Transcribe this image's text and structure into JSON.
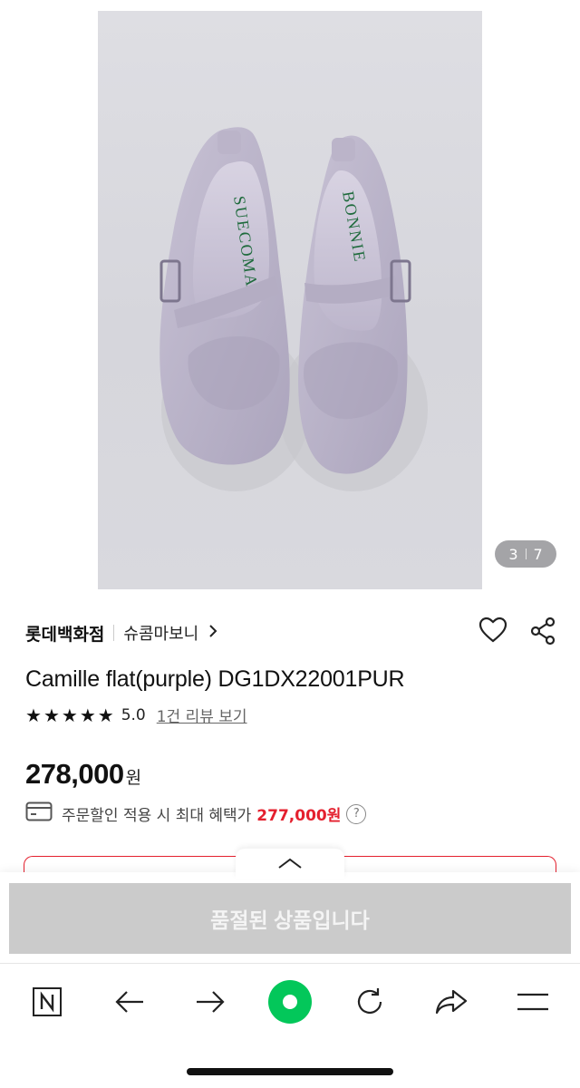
{
  "gallery": {
    "counter_current": "3",
    "counter_total": "7",
    "insole_left": "SUECOMA",
    "insole_right": "BONNIE"
  },
  "product": {
    "store": "롯데백화점",
    "brand": "슈콤마보니",
    "title": "Camille flat(purple) DG1DX22001PUR",
    "rating_value": 5.0,
    "rating_text": "5.0",
    "review_link": "1건 리뷰 보기",
    "price": "278,000",
    "price_unit": "원",
    "benefit_text": "주문할인 적용 시 최대 혜택가",
    "benefit_price": "277,000원",
    "help": "?"
  },
  "purchase": {
    "soldout_label": "품절된 상품입니다"
  },
  "icons": {
    "heart": "heart-icon",
    "share": "share-icon",
    "card": "card-icon",
    "chevron": "chevron-right-icon",
    "sheet_handle": "chevron-up-icon",
    "browser_home": "naver-n-icon",
    "back": "arrow-left-icon",
    "forward": "arrow-right-icon",
    "green_dot": "green-circle-icon",
    "reload": "reload-icon",
    "browser_share": "share-arrow-icon",
    "menu": "menu-icon"
  },
  "colors": {
    "accent_red": "#e4202e",
    "naver_green": "#03c75a",
    "soldout_gray": "#cbcbcb",
    "shoe_lilac": "#b8b2c6",
    "insole_green": "#1f6b3d"
  }
}
